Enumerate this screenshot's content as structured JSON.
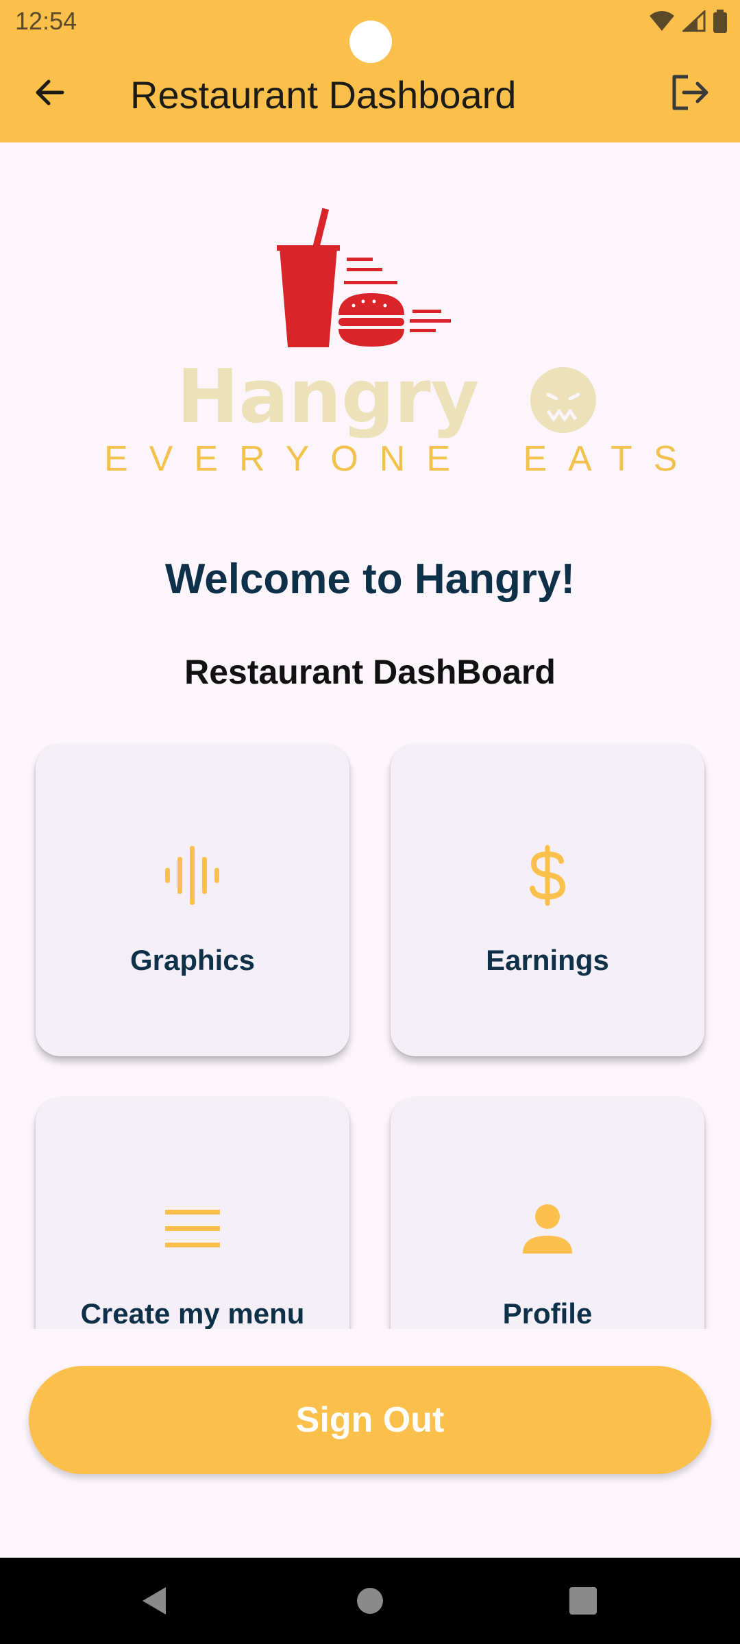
{
  "status_bar": {
    "time": "12:54",
    "icons": [
      "wifi-icon",
      "signal-icon",
      "battery-icon"
    ]
  },
  "app_bar": {
    "title": "Restaurant Dashboard",
    "back_icon": "arrow-back-icon",
    "logout_icon": "logout-icon"
  },
  "logo": {
    "wordmark": "Hangry",
    "tagline": "EVERYONE EATS"
  },
  "welcome_text": "Welcome to Hangry!",
  "subtitle": "Restaurant DashBoard",
  "cards": [
    {
      "label": "Graphics",
      "icon": "graphic-eq-icon"
    },
    {
      "label": "Earnings",
      "icon": "dollar-icon"
    },
    {
      "label": "Create my menu",
      "icon": "menu-lines-icon"
    },
    {
      "label": "Profile",
      "icon": "person-icon"
    }
  ],
  "sign_out_button": "Sign Out",
  "colors": {
    "primary": "#fbbf4b",
    "logo_red": "#d9252a",
    "text_navy": "#0f3049",
    "background": "#fcf6fc",
    "card_bg": "#f5f0f7"
  },
  "nav_bar": {
    "icons": [
      "nav-back-icon",
      "nav-home-icon",
      "nav-recents-icon"
    ]
  }
}
